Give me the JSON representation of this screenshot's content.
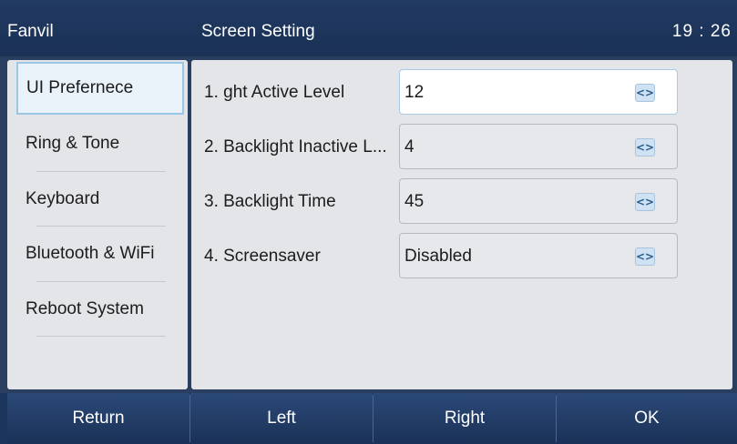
{
  "header": {
    "brand": "Fanvil",
    "title": "Screen Setting",
    "clock": "19 : 26"
  },
  "sidebar": {
    "items": [
      {
        "label": "UI Prefernece",
        "selected": true
      },
      {
        "label": "Ring & Tone",
        "selected": false
      },
      {
        "label": "Keyboard",
        "selected": false
      },
      {
        "label": "Bluetooth & WiFi",
        "selected": false
      },
      {
        "label": "Reboot System",
        "selected": false
      }
    ]
  },
  "settings": [
    {
      "label": "1. ɡht Active Level",
      "value": "12",
      "active": true,
      "icon": "left-right-arrows-icon"
    },
    {
      "label": "2. Backlight Inactive L...",
      "value": "4",
      "active": false,
      "icon": "left-right-arrows-icon"
    },
    {
      "label": "3. Backlight Time",
      "value": "45",
      "active": false,
      "icon": "left-right-arrows-icon"
    },
    {
      "label": "4. Screensaver",
      "value": "Disabled",
      "active": false,
      "icon": "left-right-arrows-icon"
    }
  ],
  "softkeys": {
    "return": "Return",
    "left": "Left",
    "right": "Right",
    "ok": "OK"
  },
  "colors": {
    "header_bg": "#1b3156",
    "selection_border": "#9cc6e6",
    "softkey_bg": "#2b4877"
  }
}
